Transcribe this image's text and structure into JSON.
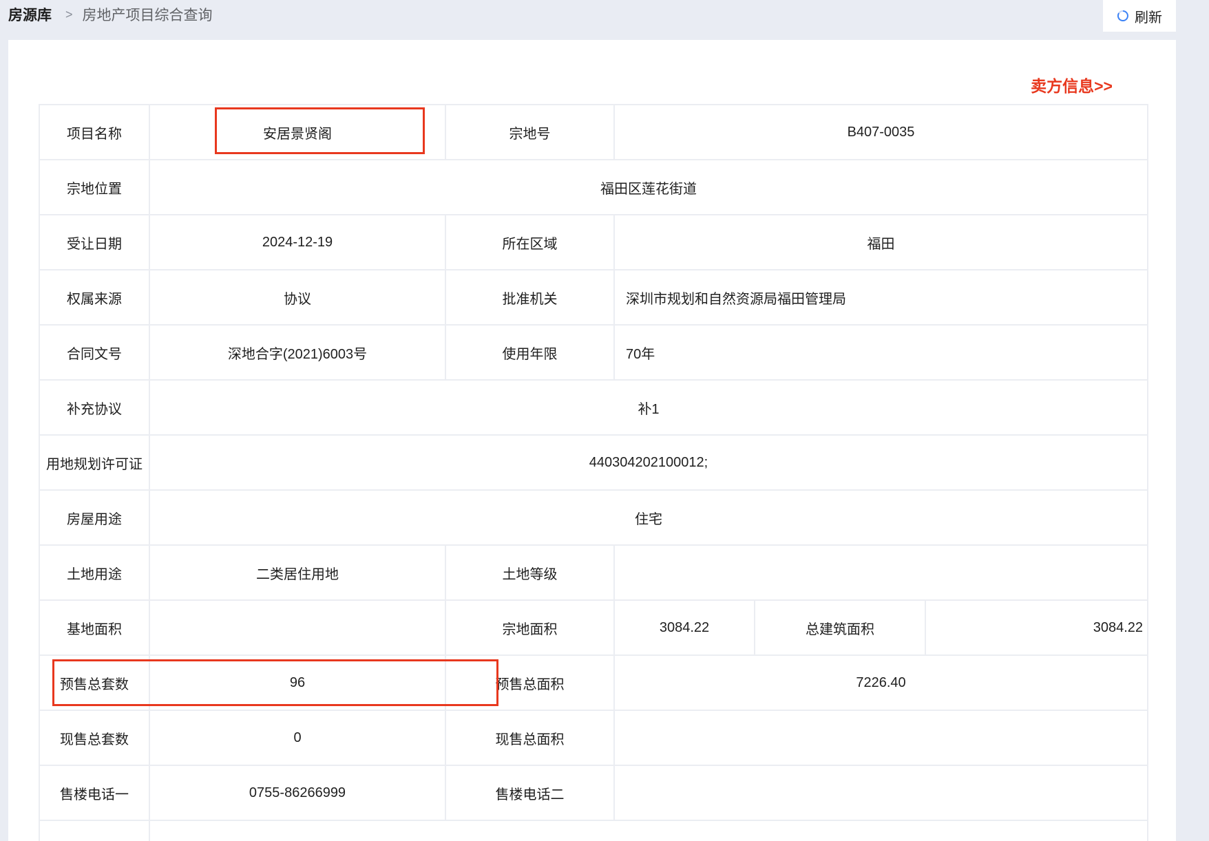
{
  "breadcrumb": {
    "root": "房源库",
    "separator": ">",
    "current": "房地产项目综合查询"
  },
  "refresh_label": "刷新",
  "seller_link": "卖方信息>>",
  "rows": {
    "r1": {
      "l1": "项目名称",
      "v1": "安居景贤阁",
      "l2": "宗地号",
      "v2": "B407-0035"
    },
    "r2": {
      "l1": "宗地位置",
      "v1": "福田区莲花街道"
    },
    "r3": {
      "l1": "受让日期",
      "v1": "2024-12-19",
      "l2": "所在区域",
      "v2": "福田"
    },
    "r4": {
      "l1": "权属来源",
      "v1": "协议",
      "l2": "批准机关",
      "v2": "深圳市规划和自然资源局福田管理局"
    },
    "r5": {
      "l1": "合同文号",
      "v1": "深地合字(2021)6003号",
      "l2": "使用年限",
      "v2": "70年"
    },
    "r6": {
      "l1": "补充协议",
      "v1": "补1"
    },
    "r7": {
      "l1": "用地规划许可证",
      "v1": "440304202100012;"
    },
    "r8": {
      "l1": "房屋用途",
      "v1": "住宅"
    },
    "r9": {
      "l1": "土地用途",
      "v1": "二类居住用地",
      "l2": "土地等级",
      "v2": ""
    },
    "r10": {
      "l1": "基地面积",
      "v1": "",
      "l2": "宗地面积",
      "v2": "3084.22",
      "l3": "总建筑面积",
      "v3": "3084.22"
    },
    "r11": {
      "l1": "预售总套数",
      "v1": "96",
      "l2": "预售总面积",
      "v2": "7226.40"
    },
    "r12": {
      "l1": "现售总套数",
      "v1": "0",
      "l2": "现售总面积",
      "v2": ""
    },
    "r13": {
      "l1": "售楼电话一",
      "v1": "0755-86266999",
      "l2": "售楼电话二",
      "v2": ""
    }
  },
  "colors": {
    "accent": "#e8381e",
    "border": "#ebedf2",
    "background": "#e9ecf3"
  }
}
